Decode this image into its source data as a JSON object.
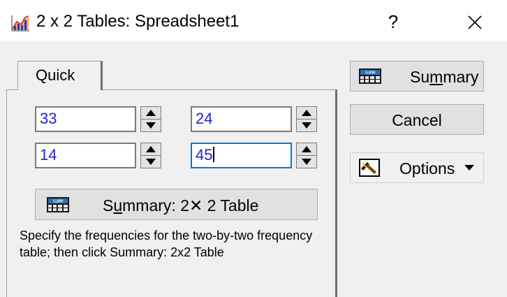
{
  "window": {
    "title": "2 x 2 Tables: Spreadsheet1",
    "help_symbol": "?",
    "icon": "chart-icon",
    "close_icon": "close-icon"
  },
  "tabs": [
    {
      "label": "Quick",
      "selected": true
    }
  ],
  "quick": {
    "cells": [
      {
        "value": "33"
      },
      {
        "value": "24"
      },
      {
        "value": "14"
      },
      {
        "value": "45",
        "focused": true
      }
    ],
    "summary_button": {
      "label_pre": "S",
      "label_underlined": "u",
      "label_post": "mmary:  2",
      "times": "✕",
      "label_end": " 2 Table",
      "icon": "summary-grid-icon"
    },
    "help_text": "Specify the frequencies for the two-by-two frequency table; then click Summary: 2x2 Table"
  },
  "side_buttons": {
    "summary": {
      "pre": "Su",
      "underlined": "m",
      "post": "mary",
      "icon": "summary-grid-icon"
    },
    "cancel": {
      "label": "Cancel"
    },
    "options": {
      "label": "Options",
      "icon": "options-icon",
      "dropdown_icon": "caret-down-icon"
    }
  },
  "colors": {
    "input_text": "#1f1fdc",
    "focus_border": "#0078d7",
    "window_bg": "#f0f0f0",
    "button_bg": "#e1e1e1"
  }
}
